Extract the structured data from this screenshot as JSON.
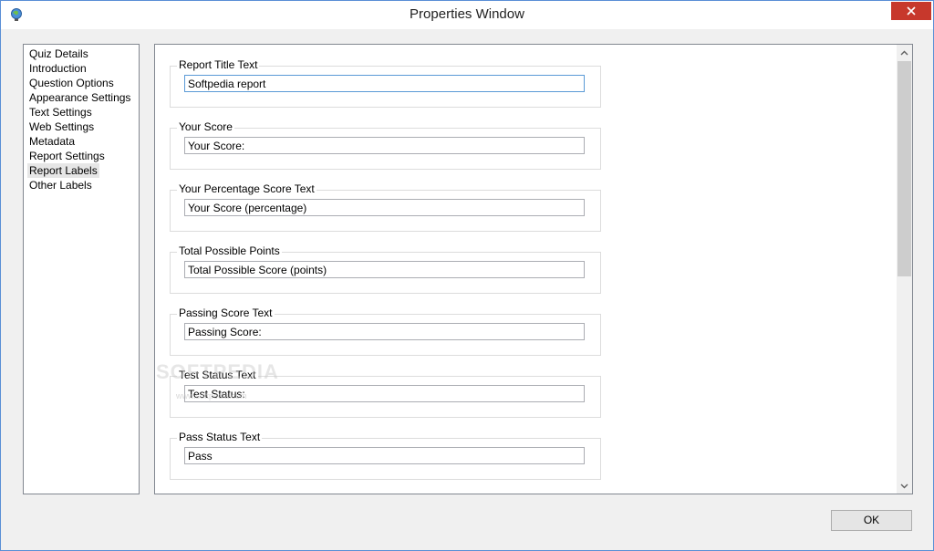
{
  "window": {
    "title": "Properties Window"
  },
  "nav": {
    "items": [
      {
        "label": "Quiz Details"
      },
      {
        "label": "Introduction"
      },
      {
        "label": "Question Options"
      },
      {
        "label": "Appearance Settings"
      },
      {
        "label": "Text Settings"
      },
      {
        "label": "Web Settings"
      },
      {
        "label": "Metadata"
      },
      {
        "label": "Report Settings"
      },
      {
        "label": "Report Labels"
      },
      {
        "label": "Other Labels"
      }
    ],
    "selected": "Report Labels"
  },
  "panel": {
    "groups": [
      {
        "label": "Report Title Text",
        "value": "Softpedia report"
      },
      {
        "label": "Your Score",
        "value": "Your Score:"
      },
      {
        "label": "Your Percentage Score Text",
        "value": "Your Score (percentage)"
      },
      {
        "label": "Total Possible Points",
        "value": "Total Possible Score (points)"
      },
      {
        "label": "Passing Score Text",
        "value": "Passing Score:"
      },
      {
        "label": "Test Status Text",
        "value": "Test Status:"
      },
      {
        "label": "Pass Status Text",
        "value": "Pass"
      }
    ]
  },
  "buttons": {
    "ok_label": "OK"
  },
  "watermark": {
    "text": "SOFTPEDIA",
    "url": "www.softpedia.com"
  },
  "icons": {
    "app": "app-globe-icon",
    "close": "close-icon",
    "scroll_up": "chevron-up-icon",
    "scroll_down": "chevron-down-icon"
  },
  "colors": {
    "close_button": "#c7382c",
    "window_border": "#5a8fd6",
    "focus_border": "#5a9ad6"
  }
}
